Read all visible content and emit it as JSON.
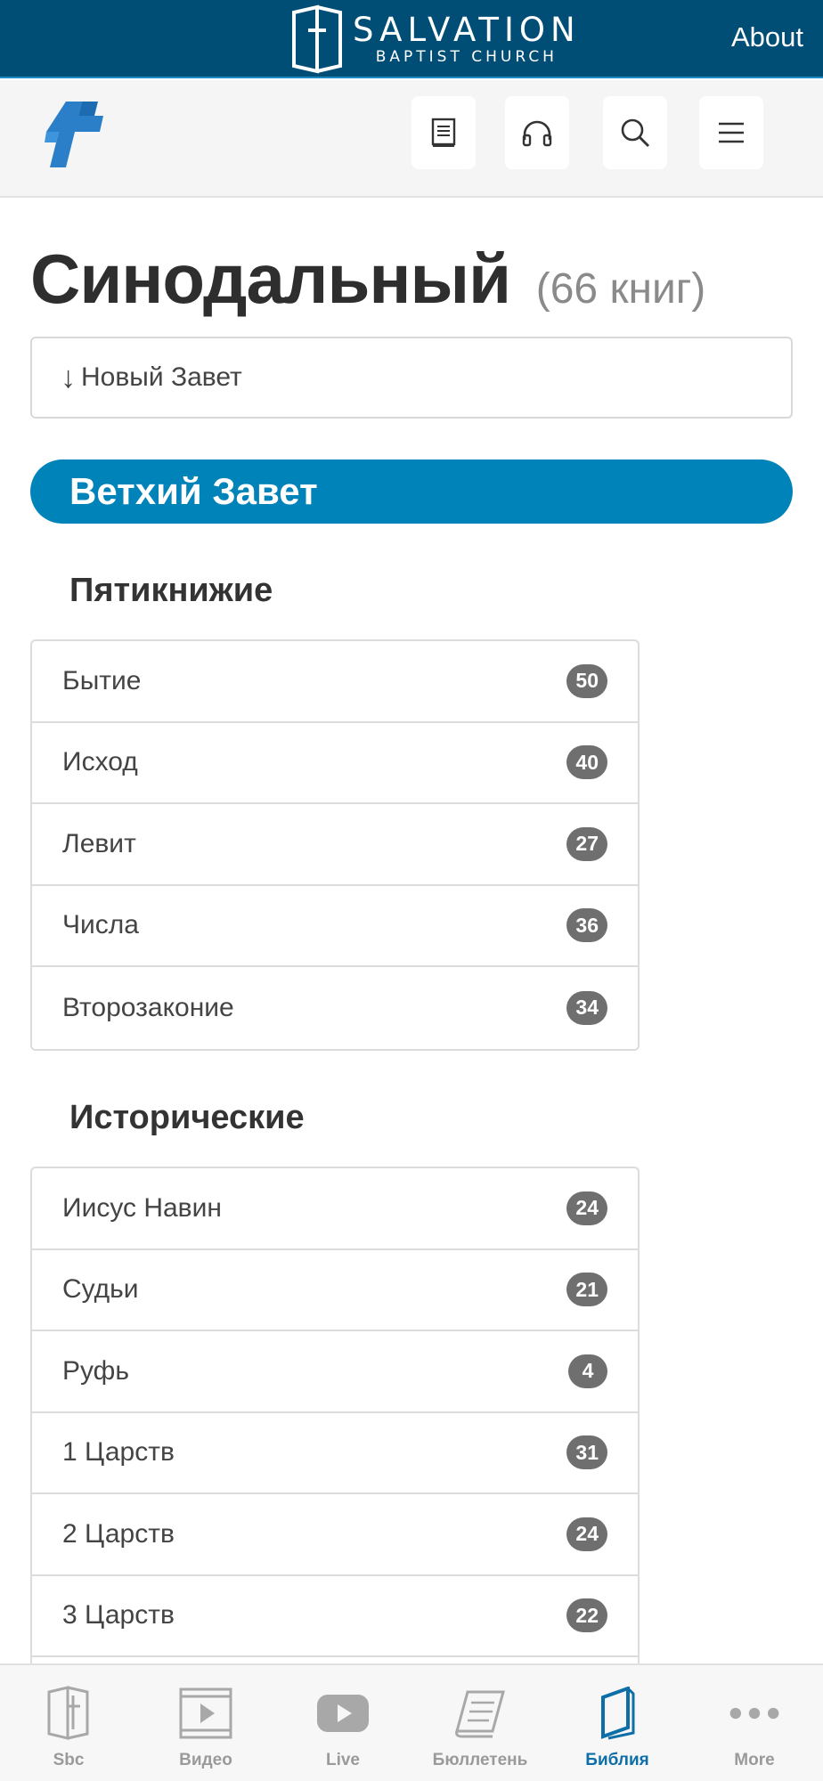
{
  "brandbar": {
    "name": "SALVATION",
    "subtitle": "BAPTIST CHURCH",
    "about_label": "About"
  },
  "header": {
    "icons": [
      "book-icon",
      "headphones-icon",
      "search-icon",
      "menu-icon"
    ]
  },
  "page": {
    "title": "Синодальный",
    "count": "(66 книг)",
    "jump_arrow": "↓",
    "jump_label": "Новый Завет",
    "testament": "Ветхий Завет"
  },
  "sections": [
    {
      "title": "Пятикнижие",
      "books": [
        {
          "name": "Бытие",
          "chapters": "50"
        },
        {
          "name": "Исход",
          "chapters": "40"
        },
        {
          "name": "Левит",
          "chapters": "27"
        },
        {
          "name": "Числа",
          "chapters": "36"
        },
        {
          "name": "Второзаконие",
          "chapters": "34"
        }
      ]
    },
    {
      "title": "Исторические",
      "books": [
        {
          "name": "Иисус Навин",
          "chapters": "24"
        },
        {
          "name": "Судьи",
          "chapters": "21"
        },
        {
          "name": "Руфь",
          "chapters": "4"
        },
        {
          "name": "1 Царств",
          "chapters": "31"
        },
        {
          "name": "2 Царств",
          "chapters": "24"
        },
        {
          "name": "3 Царств",
          "chapters": "22"
        },
        {
          "name": "",
          "chapters": ""
        }
      ]
    }
  ],
  "tabs": [
    {
      "label": "Sbc",
      "icon": "church-book-icon"
    },
    {
      "label": "Видео",
      "icon": "video-icon"
    },
    {
      "label": "Live",
      "icon": "youtube-play-icon"
    },
    {
      "label": "Бюллетень",
      "icon": "scroll-icon"
    },
    {
      "label": "Библия",
      "icon": "bible-icon"
    },
    {
      "label": "More",
      "icon": "more-dots-icon"
    }
  ],
  "colors": {
    "brand_bar": "#004d75",
    "accent": "#0083b9",
    "active_tab": "#0e6fa8",
    "badge": "#6f6f6f"
  }
}
